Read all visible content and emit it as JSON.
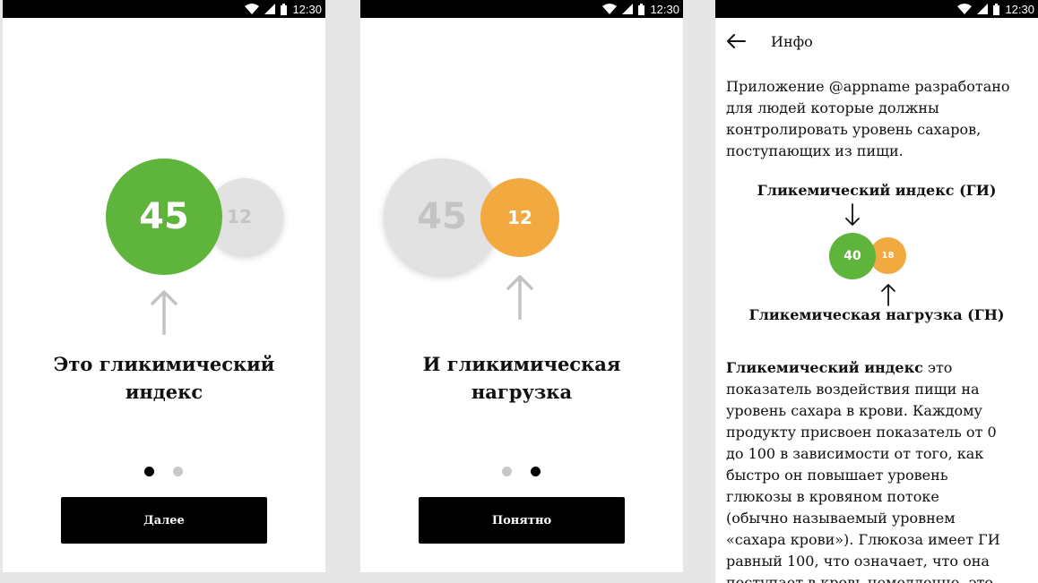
{
  "status_time": "12:30",
  "colors": {
    "green": "#5fb43c",
    "orange": "#f2a93f",
    "grey": "#e2e2e2",
    "grey_text": "#c4c4c4",
    "dot_inactive": "#c8c8c8",
    "black": "#000000"
  },
  "screen1": {
    "big_circle_value": "45",
    "small_circle_value": "12",
    "title_line1": "Это гликимический",
    "title_line2": "индекс",
    "button_label": "Далее",
    "active_page": 1
  },
  "screen2": {
    "big_circle_value": "45",
    "small_circle_value": "12",
    "title_line1": "И гликимическая",
    "title_line2": "нагрузка",
    "button_label": "Понятно",
    "active_page": 2
  },
  "screen3": {
    "back_icon": "arrow-left-icon",
    "title": "Инфо",
    "intro_lines": [
      "Приложение @appname разработано",
      "для людей которые должны",
      "контролировать уровень сахаров,",
      "поступающих из пищи."
    ],
    "gi_label": "Гликемический индекс (ГИ)",
    "gi_value": "40",
    "gn_value": "18",
    "gn_label": "Гликемическая нагрузка (ГН)",
    "body_bold": "Гликемический индекс",
    "body_first_rest": " это",
    "body_lines": [
      "показатель воздействия пищи на",
      "уровень сахара в крови. Каждому",
      "продукту присвоен показатель от 0",
      "до 100 в зависимости от того, как",
      "быстро он повышает уровень",
      "глюкозы в кровяном потоке",
      "(обычно называемый уровнем",
      "«сахара крови»). Глюкоза имеет ГИ",
      "равный 100, что означает, что она",
      "поступает в кровь немедленно, это"
    ]
  }
}
